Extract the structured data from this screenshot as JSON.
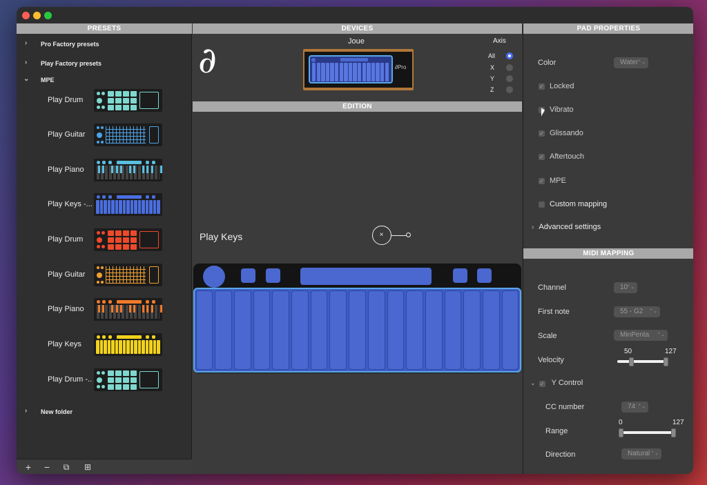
{
  "presets": {
    "header": "PRESETS",
    "folders": [
      {
        "label": "Pro Factory presets"
      },
      {
        "label": "Play Factory presets"
      },
      {
        "label": "MPE"
      },
      {
        "label": "New folder"
      }
    ],
    "items": [
      {
        "label": "Play Drum",
        "thumb": "drum",
        "color": "#7fd8cf"
      },
      {
        "label": "Play Guitar",
        "thumb": "guitar",
        "color": "#4da3e8"
      },
      {
        "label": "Play Piano",
        "thumb": "piano",
        "color": "#59bfe0"
      },
      {
        "label": "Play Keys -...",
        "thumb": "keys",
        "color": "#4a6ee0"
      },
      {
        "label": "Play Drum",
        "thumb": "drum",
        "color": "#ee4a2a"
      },
      {
        "label": "Play Guitar",
        "thumb": "guitar",
        "color": "#f0a030"
      },
      {
        "label": "Play Piano",
        "thumb": "piano",
        "color": "#f07a2a"
      },
      {
        "label": "Play Keys",
        "thumb": "keys",
        "color": "#f2d21a"
      },
      {
        "label": "Play Drum -..",
        "thumb": "drum",
        "color": "#7fd8cf"
      }
    ],
    "bottom_buttons": {
      "add": "+",
      "remove": "−",
      "duplicate": "⧉",
      "import": "⊞"
    }
  },
  "devices": {
    "header": "DEVICES",
    "device_name": "Joue",
    "logo_glyph": "∂",
    "device_badge": "∂Pro",
    "axis_title": "Axis",
    "axis_options": [
      "All",
      "X",
      "Y",
      "Z"
    ],
    "axis_selected": "All"
  },
  "edition": {
    "header": "EDITION",
    "preset_title": "Play Keys",
    "cursor_glyph": "×",
    "pad_color": "#4a68d0",
    "key_count": 17
  },
  "pad_properties": {
    "header": "PAD PROPERTIES",
    "color_label": "Color",
    "color_value": "Water",
    "checkboxes": [
      {
        "label": "Locked",
        "checked": true
      },
      {
        "label": "Vibrato",
        "checked": false
      },
      {
        "label": "Glissando",
        "checked": true
      },
      {
        "label": "Aftertouch",
        "checked": true
      },
      {
        "label": "MPE",
        "checked": true
      },
      {
        "label": "Custom mapping",
        "checked": false
      }
    ],
    "advanced_label": "Advanced settings"
  },
  "midi_mapping": {
    "header": "MIDI MAPPING",
    "channel_label": "Channel",
    "channel_value": "10",
    "first_note_label": "First note",
    "first_note_value": "55 - G2",
    "scale_label": "Scale",
    "scale_value": "MinPenta",
    "velocity_label": "Velocity",
    "velocity_min": "50",
    "velocity_max": "127",
    "y_control_label": "Y Control",
    "cc_number_label": "CC number",
    "cc_number_value": "74",
    "range_label": "Range",
    "range_min": "0",
    "range_max": "127",
    "direction_label": "Direction",
    "direction_value": "Natural"
  }
}
